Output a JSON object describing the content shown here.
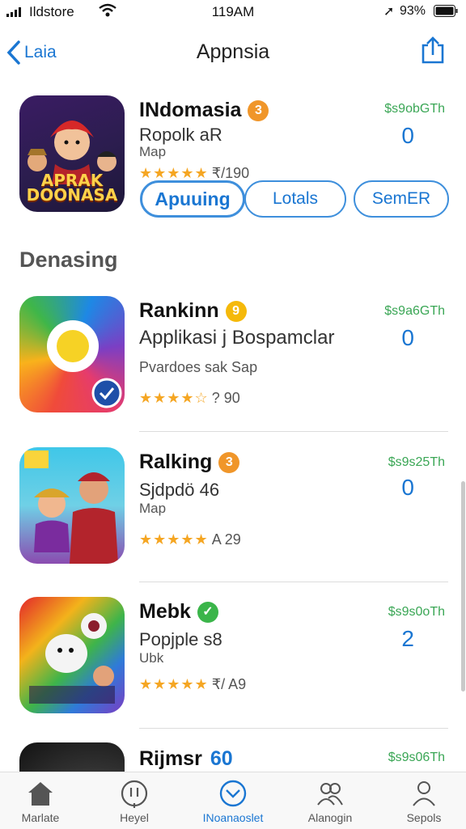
{
  "status": {
    "carrier": "Ildstore",
    "time": "119AM",
    "battery": "93%"
  },
  "nav": {
    "back_label": "Laia",
    "title": "Appnsia"
  },
  "featured": {
    "name": "INdomasia",
    "badge": "3",
    "subtitle": "Ropolk aR",
    "category": "Map",
    "stars": "★★★★★",
    "rating_count": "₹/190",
    "price": "$s9obGTh",
    "get": "0",
    "icon_text": "APRAK DOONASA",
    "buttons": [
      "Apuuing",
      "Lotals",
      "SemER"
    ]
  },
  "section_title": "Denasing",
  "apps": [
    {
      "name": "Rankinn",
      "badge": "9",
      "subtitle": "Applikasi j Bospamclar",
      "category": "Pvardoes sak Sap",
      "stars": "★★★★☆",
      "rating_count": "? 90",
      "price": "$s9a6GTh",
      "get": "0"
    },
    {
      "name": "Ralking",
      "badge": "3",
      "subtitle": "Sjdpdö 46",
      "category": "Map",
      "stars": "★★★★★",
      "rating_count": "A 29",
      "price": "$s9s25Th",
      "get": "0"
    },
    {
      "name": "Mebk",
      "badge": "✓",
      "subtitle": "Popjple s8",
      "category": "Ubk",
      "stars": "★★★★★",
      "rating_count": "₹/ A9",
      "price": "$s9s0oTh",
      "get": "2"
    },
    {
      "name": "Rijmsr",
      "badge": "60",
      "price": "$s9s06Th"
    }
  ],
  "tabs": [
    {
      "label": "Marlate",
      "icon": "home-icon"
    },
    {
      "label": "Heyel",
      "icon": "sticker-icon"
    },
    {
      "label": "INoanaoslet",
      "icon": "chevron-circle-icon"
    },
    {
      "label": "Alanogin",
      "icon": "people-icon"
    },
    {
      "label": "Sepols",
      "icon": "person-icon"
    }
  ],
  "colors": {
    "accent": "#1a76d2",
    "price": "#3aa655",
    "star": "#f5a623",
    "badge_orange": "#f0962a",
    "badge_green": "#3bb54a"
  }
}
